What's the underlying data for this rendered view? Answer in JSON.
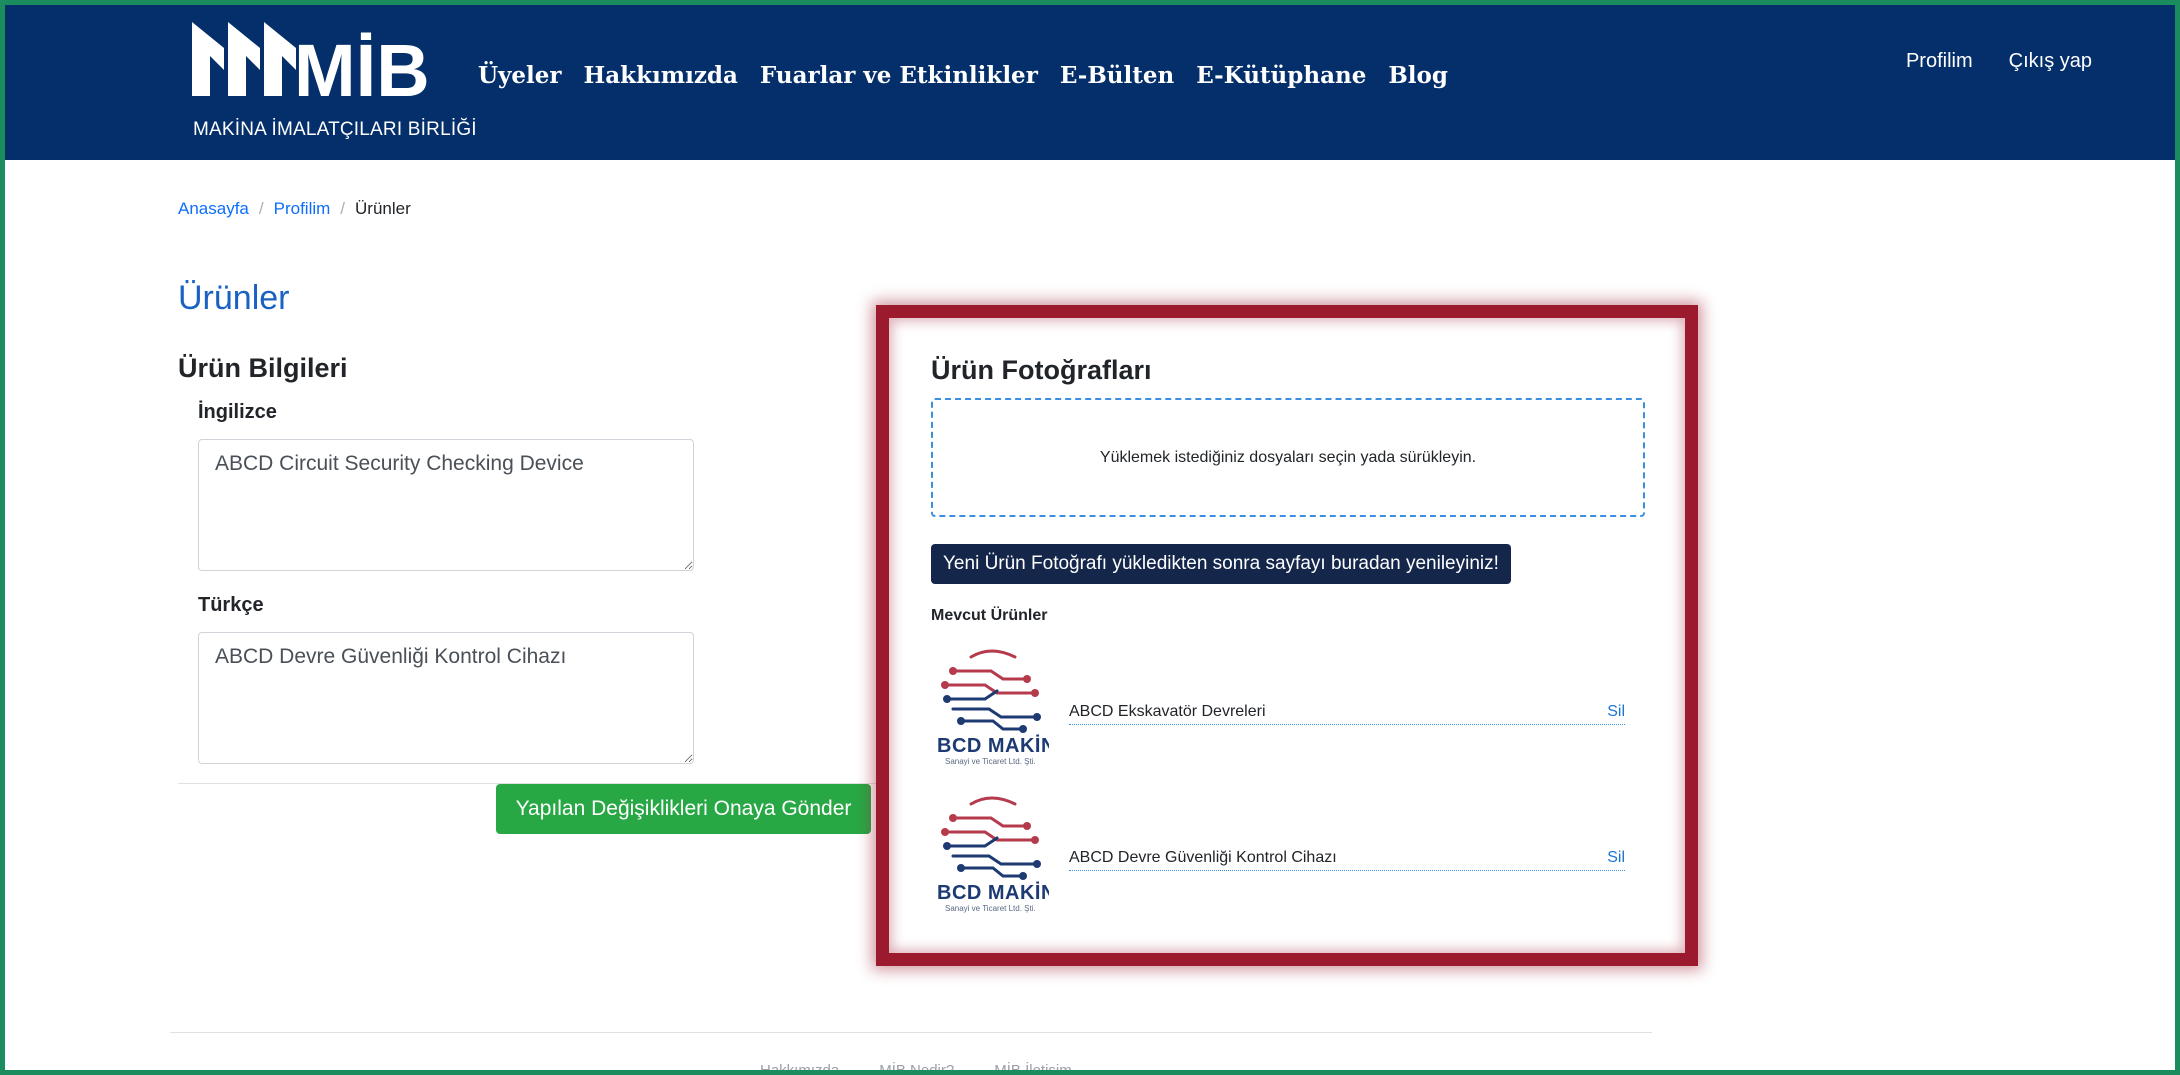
{
  "header": {
    "logo_text": "MİB",
    "logo_caption": "MAKİNA İMALATÇILARI BİRLİĞİ",
    "nav": [
      "Üyeler",
      "Hakkımızda",
      "Fuarlar ve Etkinlikler",
      "E-Bülten",
      "E-Kütüphane",
      "Blog"
    ],
    "profile_label": "Profilim",
    "logout_label": "Çıkış yap"
  },
  "breadcrumb": {
    "home": "Anasayfa",
    "profile": "Profilim",
    "current": "Ürünler",
    "separator": "/"
  },
  "page": {
    "title": "Ürünler",
    "info_title": "Ürün Bilgileri",
    "english_label": "İngilizce",
    "english_value": "ABCD Circuit Security Checking Device",
    "turkish_label": "Türkçe",
    "turkish_value": "ABCD Devre Güvenliği Kontrol Cihazı",
    "submit_label": "Yapılan Değişiklikleri Onaya Gönder"
  },
  "photos": {
    "title": "Ürün Fotoğrafları",
    "dropzone_text": "Yüklemek istediğiniz dosyaları seçin yada sürükleyin.",
    "refresh_label": "Yeni Ürün Fotoğrafı yükledikten sonra sayfayı buradan yenileyiniz!",
    "existing_heading": "Mevcut Ürünler",
    "products": [
      {
        "name": "ABCD Ekskavatör Devreleri",
        "delete_label": "Sil",
        "thumb_brand": "BCD MAKİN",
        "thumb_sub": "Sanayi ve Ticaret Ltd. Şti."
      },
      {
        "name": "ABCD Devre Güvenliği Kontrol Cihazı",
        "delete_label": "Sil",
        "thumb_brand": "BCD MAKİN",
        "thumb_sub": "Sanayi ve Ticaret Ltd. Şti."
      }
    ]
  },
  "footer": {
    "links": [
      "Hakkımızda",
      "MİB Nedir?",
      "MİB İletişim"
    ]
  },
  "colors": {
    "header_bg": "#042f6a",
    "link": "#0d6efd",
    "submit_bg": "#28a745",
    "highlight_frame": "#9c1a2e",
    "refresh_bg": "#14264a",
    "page_frame": "#1a8c5e"
  }
}
